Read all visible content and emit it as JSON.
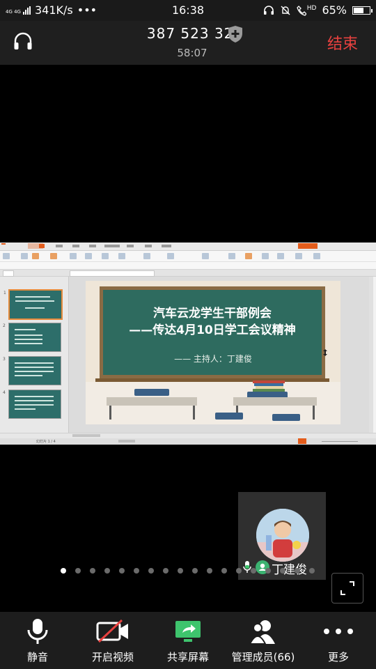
{
  "status_bar": {
    "network_type": "4G 4G",
    "speed": "341K/s",
    "more": "•••",
    "time": "16:38",
    "hd_label": "HD",
    "battery_percent": "65%",
    "battery_level": 0.65
  },
  "header": {
    "meeting_id": "387 523 323",
    "duration": "58:07",
    "end_label": "结束"
  },
  "shared_slide": {
    "title_line1": "汽车云龙学生干部例会",
    "title_line2": "——传达4月10日学工会议精神",
    "host_line": "——  主持人：丁建俊",
    "slide_counter": "幻灯片 1 / 4"
  },
  "participant": {
    "name": "丁建俊"
  },
  "pagination": {
    "total_dots": 18,
    "active_index": 0
  },
  "toolbar": {
    "mute_label": "静音",
    "video_label": "开启视频",
    "share_label": "共享屏幕",
    "members_label": "管理成员(66)",
    "more_label": "更多"
  },
  "colors": {
    "end_red": "#e8413f",
    "share_green": "#3ec46d",
    "accent_orange": "#e35c1b"
  }
}
